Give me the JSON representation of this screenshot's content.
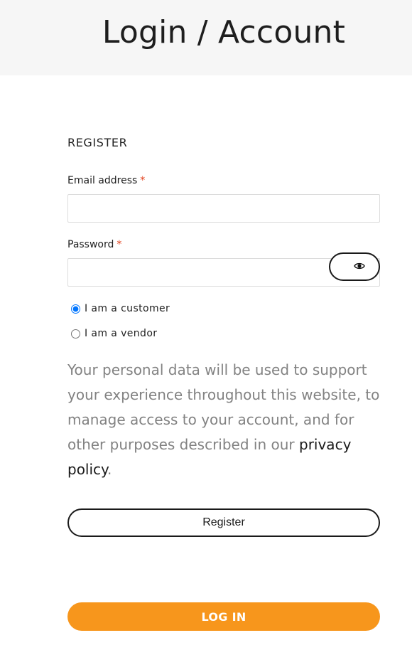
{
  "header": {
    "title": "Login / Account"
  },
  "register": {
    "heading": "REGISTER",
    "email": {
      "label": "Email address",
      "required_mark": "*",
      "value": "",
      "placeholder": ""
    },
    "password": {
      "label": "Password",
      "required_mark": "*",
      "value": "",
      "placeholder": "",
      "toggle_icon": "eye-icon"
    },
    "roles": [
      {
        "label": "I am a customer",
        "checked": true
      },
      {
        "label": "I am a vendor",
        "checked": false
      }
    ],
    "privacy": {
      "text_before": "Your personal data will be used to support your experience throughout this website, to manage access to your account, and for other purposes described in our ",
      "link_text": "privacy policy",
      "text_after": "."
    },
    "submit_label": "Register"
  },
  "login": {
    "button_label": "LOG IN"
  },
  "colors": {
    "accent_orange": "#f7961c",
    "required_red": "#e2401c",
    "header_bg": "#f6f6f6",
    "muted_text": "#828282"
  }
}
